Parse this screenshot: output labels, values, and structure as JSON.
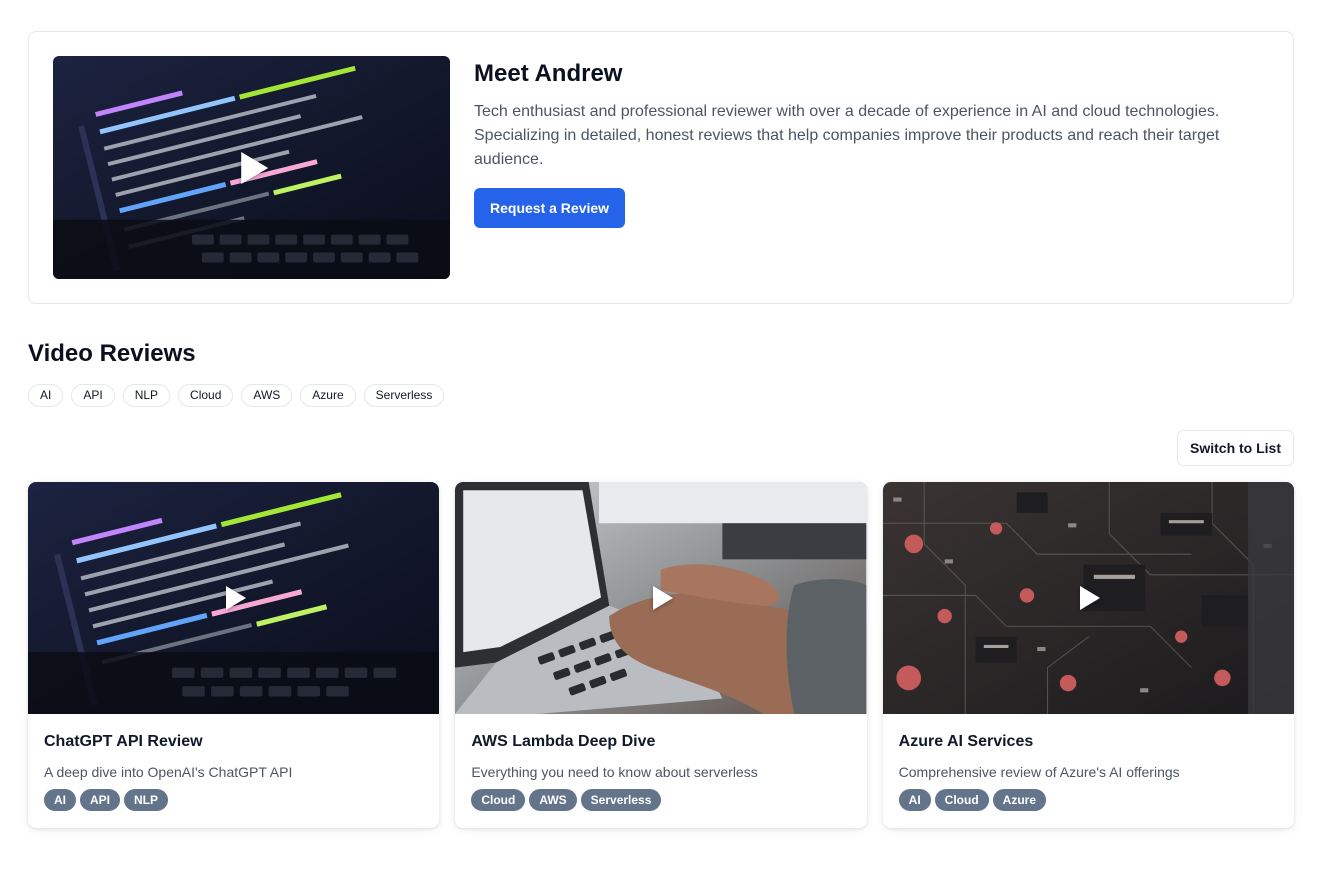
{
  "profile": {
    "title": "Meet Andrew",
    "description": "Tech enthusiast and professional reviewer with over a decade of experience in AI and cloud technologies. Specializing in detailed, honest reviews that help companies improve their products and reach their target audience.",
    "cta_label": "Request a Review",
    "video_icon": "play-icon"
  },
  "reviews": {
    "title": "Video Reviews",
    "filters": [
      "AI",
      "API",
      "NLP",
      "Cloud",
      "AWS",
      "Azure",
      "Serverless"
    ],
    "view_toggle_label": "Switch to List",
    "videos": [
      {
        "title": "ChatGPT API Review",
        "description": "A deep dive into OpenAI's ChatGPT API",
        "tags": [
          "AI",
          "API",
          "NLP"
        ],
        "thumbnail": "code-on-laptop-screen"
      },
      {
        "title": "AWS Lambda Deep Dive",
        "description": "Everything you need to know about serverless",
        "tags": [
          "Cloud",
          "AWS",
          "Serverless"
        ],
        "thumbnail": "hands-typing-on-laptop"
      },
      {
        "title": "Azure AI Services",
        "description": "Comprehensive review of Azure's AI offerings",
        "tags": [
          "AI",
          "Cloud",
          "Azure"
        ],
        "thumbnail": "circuit-board-closeup"
      }
    ]
  },
  "colors": {
    "accent": "#2563eb",
    "tag_bg": "#64748b",
    "border": "#e5e7eb",
    "text_muted": "#4b5563"
  }
}
